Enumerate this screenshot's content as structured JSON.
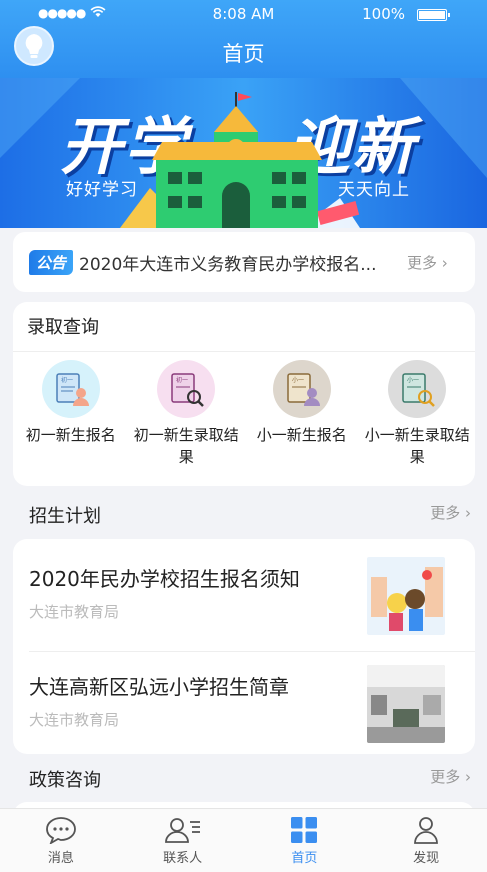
{
  "status_bar": {
    "signal": "●●●●●",
    "time": "8:08 AM",
    "battery": "100%"
  },
  "header": {
    "title": "首页"
  },
  "banner": {
    "line1a": "开学",
    "line1b": "迎新",
    "sub_left": "好好学习",
    "sub_right": "天天向上"
  },
  "notice": {
    "tag": "公告",
    "text": "2020年大连市义务教育民办学校报名...",
    "more": "更多 ›"
  },
  "admission": {
    "title": "录取查询",
    "items": [
      {
        "label": "初一新生报名",
        "icon": "form-person-icon",
        "form_label": "初一"
      },
      {
        "label": "初一新生录取结果",
        "icon": "form-search-icon",
        "form_label": "初一"
      },
      {
        "label": "小一新生报名",
        "icon": "form-person-icon",
        "form_label": "小一"
      },
      {
        "label": "小一新生录取结果",
        "icon": "form-search-icon",
        "form_label": "小一"
      }
    ]
  },
  "plan": {
    "title": "招生计划",
    "more": "更多 ›",
    "items": [
      {
        "title": "2020年民办学校招生报名须知",
        "source": "大连市教育局"
      },
      {
        "title": "大连高新区弘远小学招生简章",
        "source": "大连市教育局"
      }
    ]
  },
  "policy": {
    "title": "政策咨询",
    "more": "更多 ›"
  },
  "tabs": [
    {
      "label": "消息",
      "icon": "chat-bubble-icon",
      "active": false
    },
    {
      "label": "联系人",
      "icon": "contacts-icon",
      "active": false
    },
    {
      "label": "首页",
      "icon": "grid-home-icon",
      "active": true
    },
    {
      "label": "发现",
      "icon": "person-icon",
      "active": false
    }
  ],
  "colors": {
    "accent": "#3a8ef0",
    "header": "#3fa6f8"
  }
}
